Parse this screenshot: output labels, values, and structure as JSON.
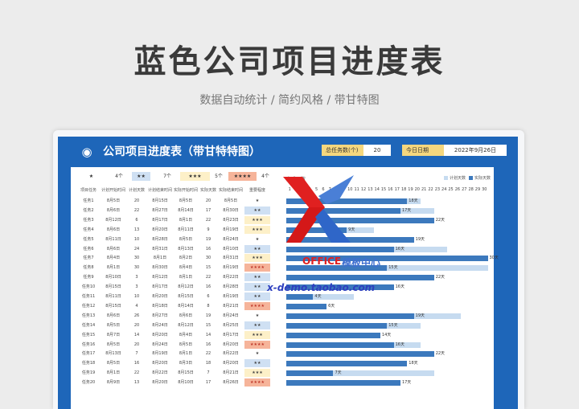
{
  "title": "蓝色公司项目进度表",
  "subtitle": "数据自动统计 / 简约风格 / 带甘特图",
  "card": {
    "icon": "chart-person-icon",
    "title": "公司项目进度表（带甘特特图）",
    "total_label": "总任务数(个)",
    "total_value": "20",
    "date_label": "今日日期",
    "date_value": "2022年9月26日"
  },
  "levels": [
    {
      "stars": "★",
      "count": "4个"
    },
    {
      "stars": "★★",
      "count": "7个"
    },
    {
      "stars": "★★★",
      "count": "5个"
    },
    {
      "stars": "★★★★",
      "count": "4个"
    }
  ],
  "table": {
    "headers": [
      "项目任务",
      "计划开始时间",
      "计划天数",
      "计划结束时间",
      "实际开始时间",
      "实际天数",
      "实际结束时间",
      "重要程度"
    ],
    "rows": [
      [
        "任务1",
        "8月5日",
        "20",
        "8月15日",
        "8月5日",
        "20",
        "8月5日",
        "★",
        1,
        20,
        18
      ],
      [
        "任务2",
        "8月6日",
        "22",
        "8月27日",
        "8月14日",
        "17",
        "8月30日",
        "★★",
        2,
        22,
        17
      ],
      [
        "任务3",
        "8月12日",
        "6",
        "8月17日",
        "8月1日",
        "22",
        "8月23日",
        "★★★",
        3,
        6,
        22
      ],
      [
        "任务4",
        "8月6日",
        "13",
        "8月20日",
        "8月11日",
        "9",
        "8月19日",
        "★★★",
        3,
        13,
        9
      ],
      [
        "任务5",
        "8月11日",
        "10",
        "8月28日",
        "8月5日",
        "19",
        "8月24日",
        "★",
        1,
        10,
        19
      ],
      [
        "任务6",
        "8月6日",
        "24",
        "8月31日",
        "8月13日",
        "16",
        "8月10日",
        "★★",
        2,
        24,
        16
      ],
      [
        "任务7",
        "8月4日",
        "30",
        "8月1日",
        "8月2日",
        "30",
        "8月31日",
        "★★★",
        3,
        30,
        30
      ],
      [
        "任务8",
        "8月1日",
        "30",
        "8月30日",
        "8月4日",
        "15",
        "8月19日",
        "★★★★",
        4,
        30,
        15
      ],
      [
        "任务9",
        "8月10日",
        "3",
        "8月12日",
        "8月1日",
        "22",
        "8月22日",
        "★★",
        2,
        3,
        22
      ],
      [
        "任务10",
        "8月15日",
        "3",
        "8月17日",
        "8月12日",
        "16",
        "8月28日",
        "★★",
        2,
        3,
        16
      ],
      [
        "任务11",
        "8月11日",
        "10",
        "8月20日",
        "8月15日",
        "6",
        "8月19日",
        "★★",
        2,
        10,
        4
      ],
      [
        "任务12",
        "8月15日",
        "4",
        "8月18日",
        "8月14日",
        "8",
        "8月21日",
        "★★★★",
        4,
        4,
        6
      ],
      [
        "任务13",
        "8月6日",
        "26",
        "8月27日",
        "8月6日",
        "19",
        "8月24日",
        "★",
        1,
        26,
        19
      ],
      [
        "任务14",
        "8月5日",
        "20",
        "8月24日",
        "8月12日",
        "15",
        "8月25日",
        "★★",
        2,
        20,
        15
      ],
      [
        "任务15",
        "8月7日",
        "14",
        "8月20日",
        "8月4日",
        "14",
        "8月17日",
        "★★★",
        3,
        14,
        14
      ],
      [
        "任务16",
        "8月5日",
        "20",
        "8月24日",
        "8月5日",
        "16",
        "8月20日",
        "★★★★",
        4,
        20,
        16
      ],
      [
        "任务17",
        "8月13日",
        "7",
        "8月19日",
        "8月1日",
        "22",
        "8月22日",
        "★",
        1,
        7,
        22
      ],
      [
        "任务18",
        "8月5日",
        "16",
        "8月20日",
        "8月3日",
        "18",
        "8月20日",
        "★★",
        2,
        16,
        18
      ],
      [
        "任务19",
        "8月1日",
        "22",
        "8月22日",
        "8月15日",
        "7",
        "8月21日",
        "★★★",
        3,
        22,
        7
      ],
      [
        "任务20",
        "8月9日",
        "13",
        "8月20日",
        "8月10日",
        "17",
        "8月26日",
        "★★★★",
        4,
        13,
        17
      ]
    ]
  },
  "gantt": {
    "title": "完成天数",
    "legend_plan": "计划天数",
    "legend_actual": "实际天数",
    "unit": "天",
    "ticks": [
      "1",
      "2",
      "3",
      "4",
      "5",
      "6",
      "7",
      "8",
      "9",
      "10",
      "11",
      "12",
      "13",
      "14",
      "15",
      "16",
      "17",
      "18",
      "19",
      "20",
      "21",
      "22",
      "23",
      "24",
      "25",
      "26",
      "27",
      "28",
      "29",
      "30"
    ],
    "colors": {
      "actual": "#3c79bd",
      "plan": "#c6dbf0"
    }
  },
  "watermark": {
    "brand": "OFFICE",
    "brand_cn": "模板中心",
    "url": "x-demo.taobao.com"
  }
}
